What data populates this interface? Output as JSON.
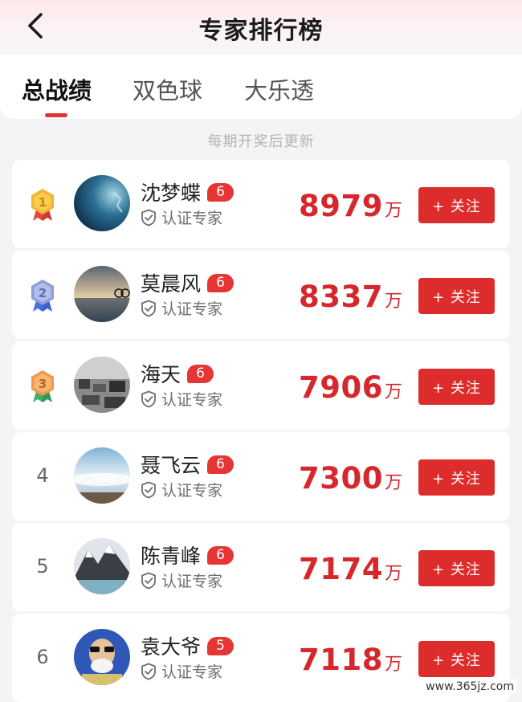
{
  "header": {
    "title": "专家排行榜",
    "back_icon": "chevron-left-icon"
  },
  "tabs": [
    {
      "label": "总战绩",
      "active": true
    },
    {
      "label": "双色球",
      "active": false
    },
    {
      "label": "大乐透",
      "active": false
    }
  ],
  "update_note": "每期开奖后更新",
  "experts": [
    {
      "rank": "1",
      "name": "沈梦蝶",
      "level": "6",
      "cert": "认证专家",
      "amount": "8979",
      "unit": "万",
      "follow": "+ 关注"
    },
    {
      "rank": "2",
      "name": "莫晨风",
      "level": "6",
      "cert": "认证专家",
      "amount": "8337",
      "unit": "万",
      "follow": "+ 关注"
    },
    {
      "rank": "3",
      "name": "海天",
      "level": "6",
      "cert": "认证专家",
      "amount": "7906",
      "unit": "万",
      "follow": "+ 关注"
    },
    {
      "rank": "4",
      "name": "聂飞云",
      "level": "6",
      "cert": "认证专家",
      "amount": "7300",
      "unit": "万",
      "follow": "+ 关注"
    },
    {
      "rank": "5",
      "name": "陈青峰",
      "level": "6",
      "cert": "认证专家",
      "amount": "7174",
      "unit": "万",
      "follow": "+ 关注"
    },
    {
      "rank": "6",
      "name": "袁大爷",
      "level": "5",
      "cert": "认证专家",
      "amount": "7118",
      "unit": "万",
      "follow": "+ 关注"
    }
  ],
  "colors": {
    "accent": "#dd2c2c",
    "gold": "#f2b62f",
    "silver": "#8f9ed8",
    "bronze": "#f09a4a"
  },
  "watermark": "www.365jz.com"
}
